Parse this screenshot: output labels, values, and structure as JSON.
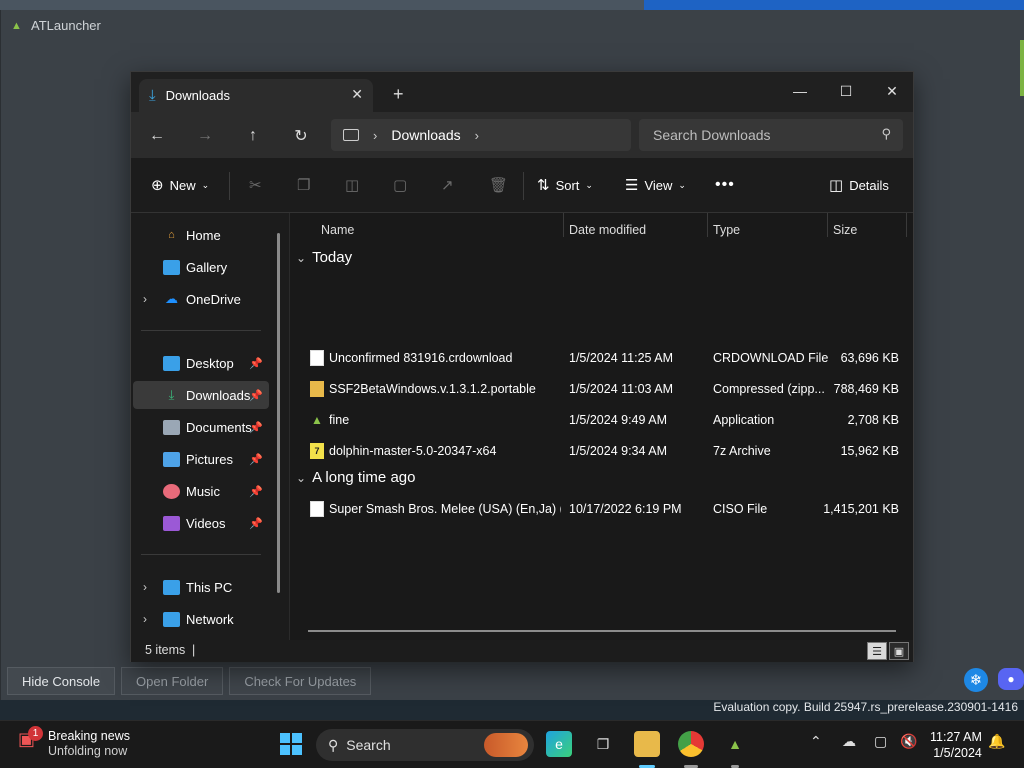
{
  "launcher": {
    "title": "ATLauncher",
    "buttons": [
      "Hide Console",
      "Open Folder",
      "Check For Updates"
    ],
    "watermark": "Evaluation copy. Build 25947.rs_prerelease.230901-1416"
  },
  "explorer": {
    "tab_label": "Downloads",
    "address": {
      "segments": [
        "Downloads"
      ]
    },
    "search_placeholder": "Search Downloads",
    "commands": {
      "new": "New",
      "sort": "Sort",
      "view": "View",
      "details": "Details"
    },
    "sidebar": {
      "items": [
        {
          "label": "Home",
          "icon": "home-icon",
          "color": "#e8a33d"
        },
        {
          "label": "Gallery",
          "icon": "gallery-icon",
          "color": "#3aa0e8"
        },
        {
          "label": "OneDrive",
          "icon": "cloud-icon",
          "color": "#1e90ff"
        },
        {
          "label": "Desktop",
          "icon": "desktop-icon",
          "color": "#3aa0e8"
        },
        {
          "label": "Downloads",
          "icon": "download-icon",
          "color": "#3bb57a",
          "selected": true
        },
        {
          "label": "Documents",
          "icon": "document-icon",
          "color": "#9aa7b5"
        },
        {
          "label": "Pictures",
          "icon": "pictures-icon",
          "color": "#4ea3e8"
        },
        {
          "label": "Music",
          "icon": "music-icon",
          "color": "#e86a7a"
        },
        {
          "label": "Videos",
          "icon": "video-icon",
          "color": "#9b59d6"
        },
        {
          "label": "This PC",
          "icon": "pc-icon",
          "color": "#3aa0e8"
        },
        {
          "label": "Network",
          "icon": "network-icon",
          "color": "#3aa0e8"
        }
      ]
    },
    "columns": [
      "Name",
      "Date modified",
      "Type",
      "Size"
    ],
    "groups": [
      {
        "title": "Today",
        "files": [
          {
            "name": "Unconfirmed 831916.crdownload",
            "date": "1/5/2024 11:25 AM",
            "type": "CRDOWNLOAD File",
            "size": "63,696 KB",
            "icon": "blank-file-icon"
          },
          {
            "name": "SSF2BetaWindows.v.1.3.1.2.portable",
            "date": "1/5/2024 11:03 AM",
            "type": "Compressed (zipp...",
            "size": "788,469 KB",
            "icon": "zip-folder-icon"
          },
          {
            "name": "fine",
            "date": "1/5/2024 9:49 AM",
            "type": "Application",
            "size": "2,708 KB",
            "icon": "app-icon"
          },
          {
            "name": "dolphin-master-5.0-20347-x64",
            "date": "1/5/2024 9:34 AM",
            "type": "7z Archive",
            "size": "15,962 KB",
            "icon": "7z-icon"
          }
        ]
      },
      {
        "title": "A long time ago",
        "files": [
          {
            "name": "Super Smash Bros. Melee (USA) (En,Ja) (R...",
            "date": "10/17/2022 6:19 PM",
            "type": "CISO File",
            "size": "1,415,201 KB",
            "icon": "blank-file-icon"
          }
        ]
      }
    ],
    "status": "5 items"
  },
  "taskbar": {
    "news_title": "Breaking news",
    "news_sub": "Unfolding now",
    "news_badge": "1",
    "search_label": "Search",
    "time": "11:27 AM",
    "date": "1/5/2024"
  }
}
